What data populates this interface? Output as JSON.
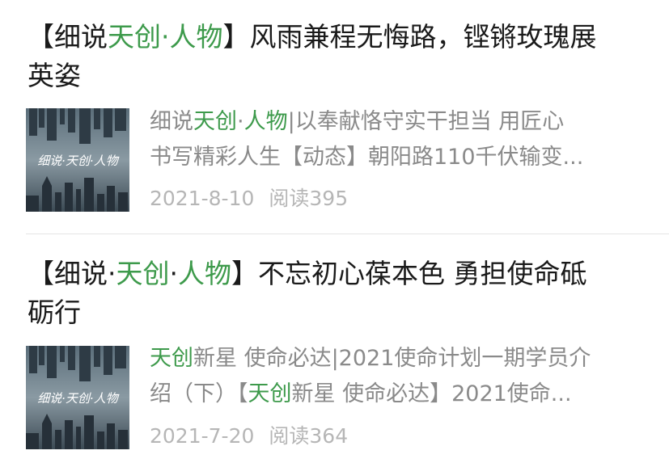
{
  "articles": [
    {
      "title_parts": [
        "【细说",
        "天创",
        "·",
        "人物",
        "】风雨兼程无悔路，铿锵玫瑰展"
      ],
      "title_line2": "英姿",
      "summary_line1_parts": [
        "细说",
        "天创",
        "·",
        "人物",
        "|以奉献恪守实干担当 用匠心"
      ],
      "summary_line2": "书写精彩人生【动态】朝阳路110千伏输变...",
      "thumb_caption": "细说·天创·人物",
      "date": "2021-8-10",
      "reads": "阅读395"
    },
    {
      "title_parts": [
        "【细说·",
        "天创",
        "·",
        "人物",
        "】不忘初心葆本色 勇担使命砥"
      ],
      "title_line2": "砺行",
      "summary_line1_parts": [
        "天创",
        "新星 使命必达|2021使命计划一期学员介"
      ],
      "summary_line2_parts": [
        "绍（下）【",
        "天创",
        "新星 使命必达】2021使命..."
      ],
      "thumb_caption": "细说·天创·人物",
      "date": "2021-7-20",
      "reads": "阅读364"
    }
  ],
  "colors": {
    "highlight": "#3d9a4b",
    "title": "#1a1a1a",
    "summary": "#8a8a8a",
    "meta": "#b6b6b6",
    "divider": "#e5e5e5"
  },
  "icons": [
    "city-skyline-thumbnail"
  ]
}
